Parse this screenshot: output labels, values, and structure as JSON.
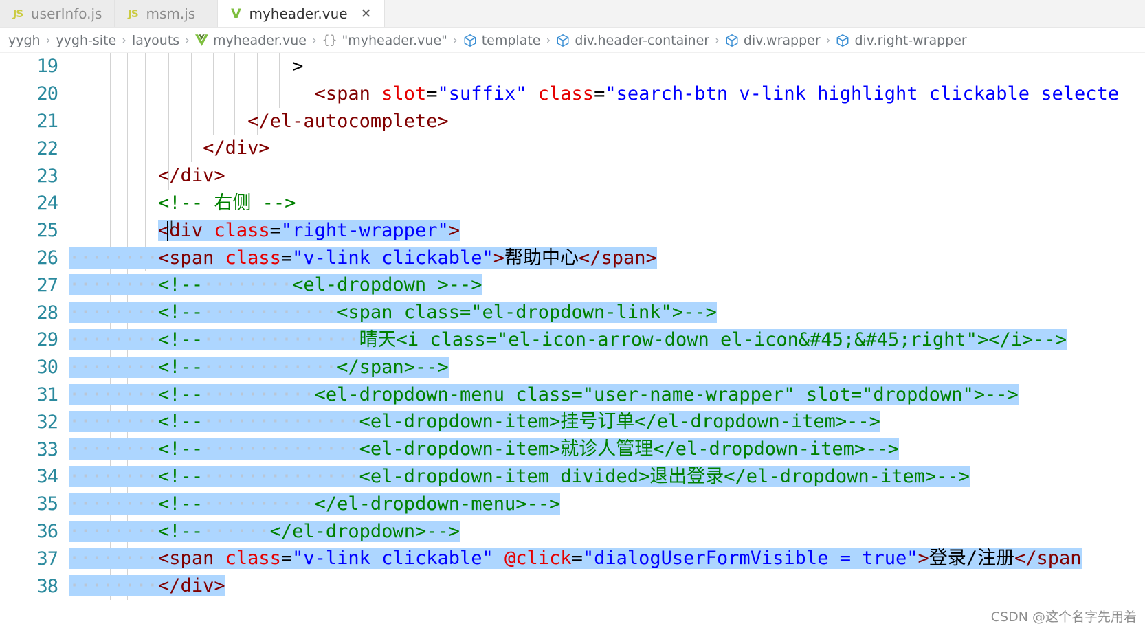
{
  "window": {
    "app": "vscode-editor"
  },
  "tabs": [
    {
      "label": "userInfo.js",
      "icon": "js-file-icon",
      "icon_glyph": "JS",
      "active": false,
      "closeable": false
    },
    {
      "label": "msm.js",
      "icon": "js-file-icon",
      "icon_glyph": "JS",
      "active": false,
      "closeable": false
    },
    {
      "label": "myheader.vue",
      "icon": "vue-file-icon",
      "icon_glyph": "V",
      "active": true,
      "closeable": true,
      "close_glyph": "✕"
    }
  ],
  "breadcrumb": {
    "separator": "›",
    "items": [
      {
        "label": "yygh",
        "icon": ""
      },
      {
        "label": "yygh-site",
        "icon": ""
      },
      {
        "label": "layouts",
        "icon": ""
      },
      {
        "label": "myheader.vue",
        "icon": "vue-file-icon"
      },
      {
        "label": "\"myheader.vue\"",
        "icon": "braces-icon",
        "icon_glyph": "{}"
      },
      {
        "label": "template",
        "icon": "html-element-icon"
      },
      {
        "label": "div.header-container",
        "icon": "html-element-icon"
      },
      {
        "label": "div.wrapper",
        "icon": "html-element-icon"
      },
      {
        "label": "div.right-wrapper",
        "icon": "html-element-icon"
      }
    ]
  },
  "editor": {
    "first_visible_line": 19,
    "selection_color": "#add6ff",
    "colors": {
      "tag": "#800000",
      "attribute": "#e50000",
      "attribute_value": "#0000ff",
      "comment": "#008000",
      "line_number": "#2b8a9e",
      "background": "#ffffff"
    },
    "lines": [
      {
        "n": "19",
        "tokens": [
          {
            "t": "plain",
            "s": "                    >"
          }
        ]
      },
      {
        "n": "20",
        "tokens": [
          {
            "t": "plain",
            "s": "                      "
          },
          {
            "t": "tag",
            "s": "<span "
          },
          {
            "t": "attr",
            "s": "slot"
          },
          {
            "t": "punc",
            "s": "="
          },
          {
            "t": "val",
            "s": "\"suffix\""
          },
          {
            "t": "plain",
            "s": " "
          },
          {
            "t": "attr",
            "s": "class"
          },
          {
            "t": "punc",
            "s": "="
          },
          {
            "t": "val",
            "s": "\"search-btn v-link highlight clickable selecte"
          }
        ]
      },
      {
        "n": "21",
        "tokens": [
          {
            "t": "plain",
            "s": "                "
          },
          {
            "t": "tag",
            "s": "</el-autocomplete>"
          }
        ]
      },
      {
        "n": "22",
        "tokens": [
          {
            "t": "plain",
            "s": "            "
          },
          {
            "t": "tag",
            "s": "</div>"
          }
        ]
      },
      {
        "n": "23",
        "tokens": [
          {
            "t": "plain",
            "s": "        "
          },
          {
            "t": "tag",
            "s": "</div>"
          }
        ]
      },
      {
        "n": "24",
        "tokens": [
          {
            "t": "plain",
            "s": "        "
          },
          {
            "t": "cmt",
            "s": "<!-- 右侧 -->"
          }
        ]
      },
      {
        "n": "25",
        "sel_start": 8,
        "tokens": [
          {
            "t": "plain",
            "s": "        "
          },
          {
            "t": "tag",
            "s": "<div "
          },
          {
            "t": "attr",
            "s": "class"
          },
          {
            "t": "punc",
            "s": "="
          },
          {
            "t": "val",
            "s": "\"right-wrapper\""
          },
          {
            "t": "tag",
            "s": ">"
          }
        ]
      },
      {
        "n": "26",
        "sel_start": 0,
        "tokens": [
          {
            "t": "ws",
            "s": "········"
          },
          {
            "t": "tag",
            "s": "<span "
          },
          {
            "t": "attr",
            "s": "class"
          },
          {
            "t": "punc",
            "s": "="
          },
          {
            "t": "val",
            "s": "\"v-link clickable\""
          },
          {
            "t": "tag",
            "s": ">"
          },
          {
            "t": "plain",
            "s": "帮助中心"
          },
          {
            "t": "tag",
            "s": "</span>"
          }
        ]
      },
      {
        "n": "27",
        "sel_start": 0,
        "tokens": [
          {
            "t": "ws",
            "s": "········"
          },
          {
            "t": "cmt",
            "s": "<!--"
          },
          {
            "t": "ws",
            "s": "········"
          },
          {
            "t": "cmt",
            "s": "<el-dropdown >-->"
          }
        ]
      },
      {
        "n": "28",
        "sel_start": 0,
        "tokens": [
          {
            "t": "ws",
            "s": "········"
          },
          {
            "t": "cmt",
            "s": "<!--"
          },
          {
            "t": "ws",
            "s": "············"
          },
          {
            "t": "cmt",
            "s": "<span class=\"el-dropdown-link\">-->"
          }
        ]
      },
      {
        "n": "29",
        "sel_start": 0,
        "tokens": [
          {
            "t": "ws",
            "s": "········"
          },
          {
            "t": "cmt",
            "s": "<!--"
          },
          {
            "t": "ws",
            "s": "··············"
          },
          {
            "t": "cmt",
            "s": "晴天<i class=\"el-icon-arrow-down el-icon&#45;&#45;right\"></i>-->"
          }
        ]
      },
      {
        "n": "30",
        "sel_start": 0,
        "tokens": [
          {
            "t": "ws",
            "s": "········"
          },
          {
            "t": "cmt",
            "s": "<!--"
          },
          {
            "t": "ws",
            "s": "············"
          },
          {
            "t": "cmt",
            "s": "</span>-->"
          }
        ]
      },
      {
        "n": "31",
        "sel_start": 0,
        "tokens": [
          {
            "t": "ws",
            "s": "········"
          },
          {
            "t": "cmt",
            "s": "<!--"
          },
          {
            "t": "ws",
            "s": "··········"
          },
          {
            "t": "cmt",
            "s": "<el-dropdown-menu class=\"user-name-wrapper\" slot=\"dropdown\">-->"
          }
        ]
      },
      {
        "n": "32",
        "sel_start": 0,
        "tokens": [
          {
            "t": "ws",
            "s": "········"
          },
          {
            "t": "cmt",
            "s": "<!--"
          },
          {
            "t": "ws",
            "s": "··············"
          },
          {
            "t": "cmt",
            "s": "<el-dropdown-item>挂号订单</el-dropdown-item>-->"
          }
        ]
      },
      {
        "n": "33",
        "sel_start": 0,
        "tokens": [
          {
            "t": "ws",
            "s": "········"
          },
          {
            "t": "cmt",
            "s": "<!--"
          },
          {
            "t": "ws",
            "s": "··············"
          },
          {
            "t": "cmt",
            "s": "<el-dropdown-item>就诊人管理</el-dropdown-item>-->"
          }
        ]
      },
      {
        "n": "34",
        "sel_start": 0,
        "tokens": [
          {
            "t": "ws",
            "s": "········"
          },
          {
            "t": "cmt",
            "s": "<!--"
          },
          {
            "t": "ws",
            "s": "··············"
          },
          {
            "t": "cmt",
            "s": "<el-dropdown-item divided>退出登录</el-dropdown-item>-->"
          }
        ]
      },
      {
        "n": "35",
        "sel_start": 0,
        "tokens": [
          {
            "t": "ws",
            "s": "········"
          },
          {
            "t": "cmt",
            "s": "<!--"
          },
          {
            "t": "ws",
            "s": "··········"
          },
          {
            "t": "cmt",
            "s": "</el-dropdown-menu>-->"
          }
        ]
      },
      {
        "n": "36",
        "sel_start": 0,
        "tokens": [
          {
            "t": "ws",
            "s": "········"
          },
          {
            "t": "cmt",
            "s": "<!--"
          },
          {
            "t": "ws",
            "s": "······"
          },
          {
            "t": "cmt",
            "s": "</el-dropdown>-->"
          }
        ]
      },
      {
        "n": "37",
        "sel_start": 0,
        "tokens": [
          {
            "t": "ws",
            "s": "········"
          },
          {
            "t": "tag",
            "s": "<span "
          },
          {
            "t": "attr",
            "s": "class"
          },
          {
            "t": "punc",
            "s": "="
          },
          {
            "t": "val",
            "s": "\"v-link clickable\""
          },
          {
            "t": "plain",
            "s": " "
          },
          {
            "t": "attr",
            "s": "@click"
          },
          {
            "t": "punc",
            "s": "="
          },
          {
            "t": "val",
            "s": "\"dialogUserFormVisible = true\""
          },
          {
            "t": "tag",
            "s": ">"
          },
          {
            "t": "plain",
            "s": "登录/注册"
          },
          {
            "t": "tag",
            "s": "</span"
          }
        ]
      },
      {
        "n": "38",
        "sel_start": 0,
        "tokens": [
          {
            "t": "ws",
            "s": "········"
          },
          {
            "t": "tag",
            "s": "</div>"
          }
        ]
      }
    ]
  },
  "watermark": {
    "text": "CSDN @这个名字先用着"
  }
}
